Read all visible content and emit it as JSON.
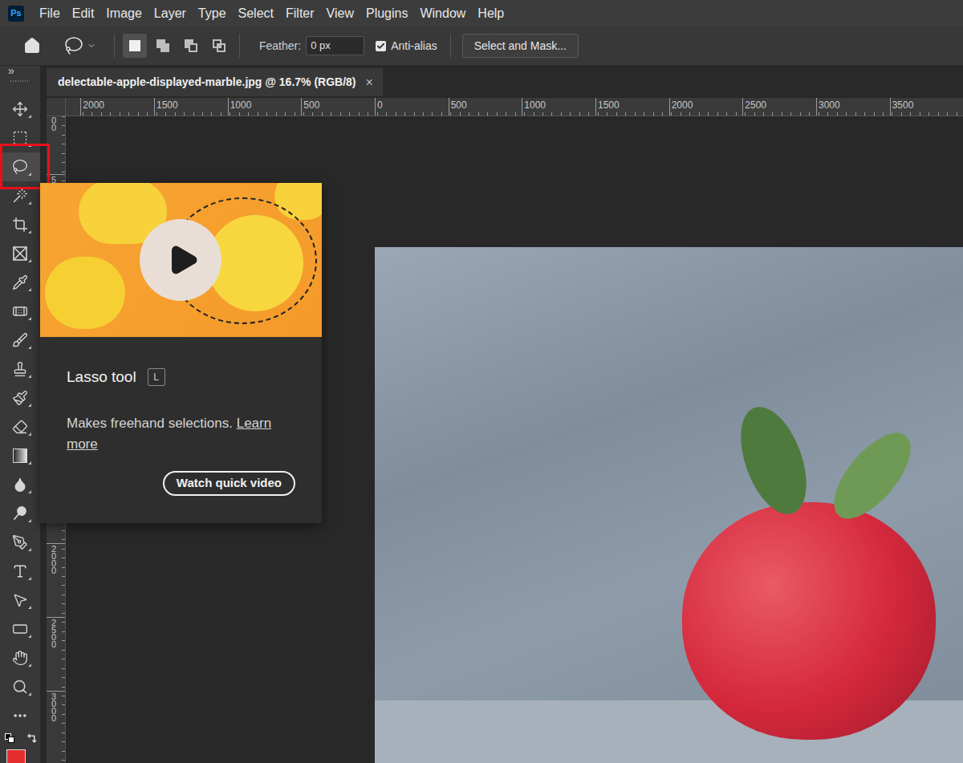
{
  "app": {
    "logo": "Ps"
  },
  "menu": [
    "File",
    "Edit",
    "Image",
    "Layer",
    "Type",
    "Select",
    "Filter",
    "View",
    "Plugins",
    "Window",
    "Help"
  ],
  "options_bar": {
    "modes": [
      {
        "selected": true
      },
      {
        "selected": false
      },
      {
        "selected": false
      },
      {
        "selected": false
      }
    ],
    "feather_label": "Feather:",
    "feather_value": "0 px",
    "anti_alias": {
      "label": "Anti-alias",
      "checked": true
    },
    "select_and_mask": "Select and Mask..."
  },
  "toolbar": {
    "collapse": "»",
    "tools": [
      {
        "selected": false
      },
      {
        "selected": false
      },
      {
        "selected": true
      },
      {
        "selected": false
      },
      {
        "selected": false
      },
      {
        "selected": false
      },
      {
        "selected": false
      },
      {
        "selected": false
      },
      {
        "selected": false
      },
      {
        "selected": false
      },
      {
        "selected": false
      },
      {
        "selected": false
      },
      {
        "selected": false
      },
      {
        "selected": false
      },
      {
        "selected": false
      },
      {
        "selected": false
      },
      {
        "selected": false
      },
      {
        "selected": false
      },
      {
        "selected": false
      },
      {
        "selected": false
      },
      {
        "selected": false
      },
      {
        "selected": false
      }
    ]
  },
  "document_tab": {
    "title": "delectable-apple-displayed-marble.jpg @ 16.7% (RGB/8)",
    "close": "×",
    "selected": true
  },
  "rulers": {
    "horizontal": [
      "2000",
      "1500",
      "1000",
      "500",
      "0",
      "500",
      "1000",
      "1500",
      "2000",
      "2500",
      "3000",
      "3500"
    ],
    "vertical": [
      "00",
      "5",
      "2000",
      "2500",
      "3000"
    ]
  },
  "tooltip": {
    "title": "Lasso tool",
    "shortcut": "L",
    "description": "Makes freehand selections.",
    "link": "Learn more",
    "button": "Watch quick video"
  }
}
